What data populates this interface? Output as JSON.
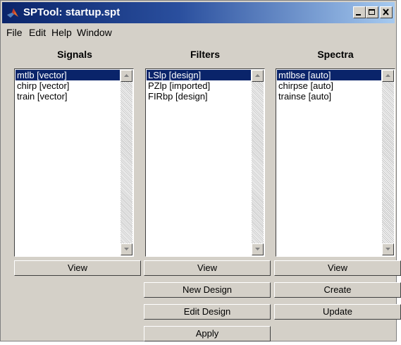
{
  "window": {
    "title": "SPTool: startup.spt",
    "controls": [
      "minimize-icon",
      "maximize-icon",
      "close-icon"
    ]
  },
  "menu": [
    "File",
    "Edit",
    "Help",
    "Window"
  ],
  "signals": {
    "heading": "Signals",
    "items": [
      "mtlb [vector]",
      "chirp [vector]",
      "train [vector]"
    ],
    "selected": "mtlb [vector]",
    "view_label": "View"
  },
  "filters": {
    "heading": "Filters",
    "items": [
      "LSlp [design]",
      "PZlp [imported]",
      "FIRbp [design]"
    ],
    "selected": "LSlp [design]",
    "view_label": "View",
    "new_design_label": "New Design",
    "edit_design_label": "Edit Design",
    "apply_label": "Apply"
  },
  "spectra": {
    "heading": "Spectra",
    "items": [
      "mtlbse [auto]",
      "chirpse [auto]",
      "trainse [auto]"
    ],
    "selected": "mtlbse [auto]",
    "view_label": "View",
    "create_label": "Create",
    "update_label": "Update"
  },
  "colors": {
    "title_bar_start": "#0a246a",
    "title_bar_end": "#a6caf0",
    "selection": "#0a246a",
    "face": "#d4d0c8"
  }
}
